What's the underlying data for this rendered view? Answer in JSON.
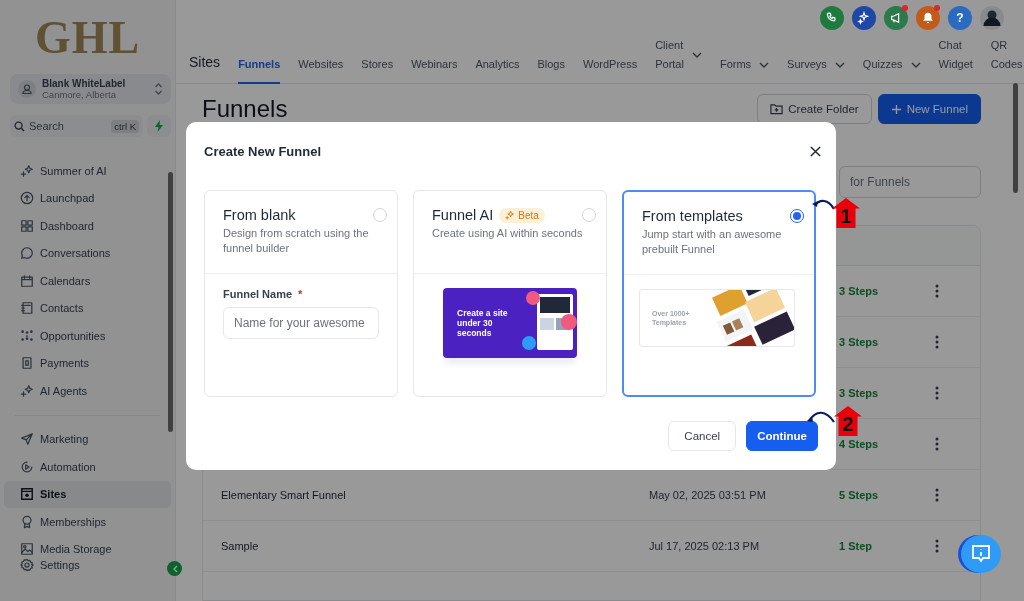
{
  "logo": {
    "text": "GHL"
  },
  "account": {
    "name": "Blank WhiteLabel",
    "location": "Canmore, Alberta"
  },
  "sidebar_search": {
    "placeholder": "Search",
    "shortcut": "ctrl K"
  },
  "sidebar": {
    "sections": [
      {
        "items": [
          {
            "label": "Summer of AI",
            "selected": false
          },
          {
            "label": "Launchpad",
            "selected": false
          },
          {
            "label": "Dashboard",
            "selected": false
          },
          {
            "label": "Conversations",
            "selected": false
          },
          {
            "label": "Calendars",
            "selected": false
          },
          {
            "label": "Contacts",
            "selected": false
          },
          {
            "label": "Opportunities",
            "selected": false
          },
          {
            "label": "Payments",
            "selected": false
          },
          {
            "label": "AI Agents",
            "selected": false
          }
        ]
      },
      {
        "items": [
          {
            "label": "Marketing",
            "selected": false
          },
          {
            "label": "Automation",
            "selected": false
          },
          {
            "label": "Sites",
            "selected": true
          },
          {
            "label": "Memberships",
            "selected": false
          },
          {
            "label": "Media Storage",
            "selected": false
          }
        ]
      }
    ],
    "settings": {
      "label": "Settings"
    }
  },
  "header_icons": [
    {
      "color": "#1e7a3e",
      "badge": false
    },
    {
      "color": "#1f47a8",
      "badge": false
    },
    {
      "color": "#2a7a4a",
      "badge": true
    },
    {
      "color": "#c45a1a",
      "badge": true
    },
    {
      "color": "#2a6ac0",
      "badge": false,
      "label": "?"
    }
  ],
  "section_title": "Sites",
  "tabs": [
    {
      "label": "Funnels",
      "selected": true,
      "has_menu": false
    },
    {
      "label": "Websites",
      "selected": false,
      "has_menu": false
    },
    {
      "label": "Stores",
      "selected": false,
      "has_menu": false
    },
    {
      "label": "Webinars",
      "selected": false,
      "has_menu": false
    },
    {
      "label": "Analytics",
      "selected": false,
      "has_menu": false
    },
    {
      "label": "Blogs",
      "selected": false,
      "has_menu": false
    },
    {
      "label": "WordPress",
      "selected": false,
      "has_menu": false
    },
    {
      "label": "Client Portal",
      "selected": false,
      "has_menu": true
    },
    {
      "label": "Forms",
      "selected": false,
      "has_menu": true
    },
    {
      "label": "Surveys",
      "selected": false,
      "has_menu": true
    },
    {
      "label": "Quizzes",
      "selected": false,
      "has_menu": true
    },
    {
      "label": "Chat Widget",
      "selected": false,
      "has_menu": false
    },
    {
      "label": "QR Codes",
      "selected": false,
      "has_menu": false
    }
  ],
  "page_title": "Funnels",
  "actions": [
    {
      "kind": "secondary",
      "label": "Create Folder"
    },
    {
      "kind": "primary",
      "label": "New Funnel"
    }
  ],
  "search": {
    "placeholder": "for Funnels"
  },
  "table": {
    "rows": [
      {
        "steps": "3 Steps"
      },
      {
        "steps": "3 Steps"
      },
      {
        "steps": "3 Steps"
      },
      {
        "steps": "4 Steps"
      },
      {
        "name": "Elementary Smart Funnel",
        "date": "May 02, 2025 03:51 PM",
        "steps": "5 Steps"
      },
      {
        "name": "Sample",
        "date": "Jul 17, 2025 02:13 PM",
        "steps": "1 Step"
      }
    ]
  },
  "modal": {
    "title": "Create New Funnel",
    "options": [
      {
        "kind": "form",
        "title": "From blank",
        "description": "Design from scratch using the funnel builder",
        "selected": false,
        "field": {
          "label": "Funnel Name",
          "required_mark": "*",
          "placeholder": "Name for your awesome"
        }
      },
      {
        "kind": "ai",
        "title": "Funnel AI",
        "badge": "Beta",
        "description": "Create using AI within seconds",
        "selected": false,
        "banner_text": "Create a site under 30 seconds"
      },
      {
        "kind": "templates",
        "title": "From templates",
        "description": "Jump start with an awesome prebuilt Funnel",
        "selected": true,
        "banner_text": "Over 1000+ Templates"
      }
    ],
    "buttons": [
      {
        "kind": "secondary",
        "label": "Cancel"
      },
      {
        "kind": "primary",
        "label": "Continue"
      }
    ]
  },
  "annotations": [
    {
      "label": "1"
    },
    {
      "label": "2"
    }
  ]
}
